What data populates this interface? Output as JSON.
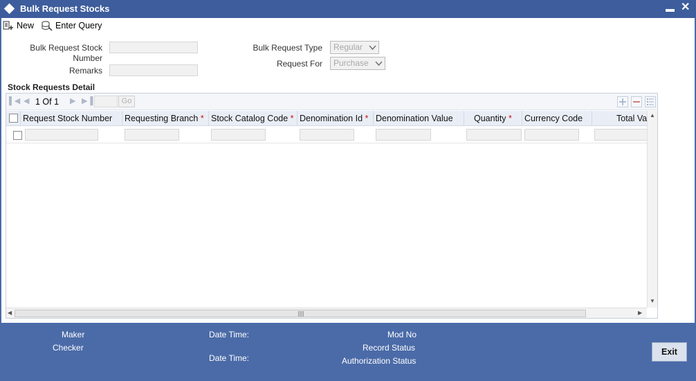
{
  "window": {
    "title": "Bulk Request Stocks",
    "minimize_label": "▬",
    "close_label": "✕"
  },
  "toolbar": {
    "new_label": "New",
    "enter_query_label": "Enter Query"
  },
  "form": {
    "bulk_request_stock_number_label": "Bulk Request Stock Number",
    "remarks_label": "Remarks",
    "bulk_request_type_label": "Bulk Request Type",
    "bulk_request_type_value": "Regular",
    "request_for_label": "Request For",
    "request_for_value": "Purchase"
  },
  "grid": {
    "section_title": "Stock Requests Detail",
    "pager_text": "1 Of 1",
    "go_label": "Go",
    "columns": [
      {
        "label": "Request Stock Number",
        "required": false
      },
      {
        "label": "Requesting Branch",
        "required": true
      },
      {
        "label": "Stock Catalog Code",
        "required": true
      },
      {
        "label": "Denomination Id",
        "required": true
      },
      {
        "label": "Denomination Value",
        "required": false
      },
      {
        "label": "Quantity",
        "required": true
      },
      {
        "label": "Currency Code",
        "required": false
      },
      {
        "label": "Total Va",
        "required": false
      }
    ],
    "required_mark": "*"
  },
  "footer": {
    "maker_label": "Maker",
    "checker_label": "Checker",
    "date_time_label_1": "Date Time:",
    "date_time_label_2": "Date Time:",
    "mod_no_label": "Mod No",
    "record_status_label": "Record Status",
    "authorization_status_label": "Authorization Status",
    "exit_label": "Exit"
  },
  "colors": {
    "title_bar": "#3d5d9c",
    "footer": "#4b6ba8",
    "required": "#d01010"
  }
}
